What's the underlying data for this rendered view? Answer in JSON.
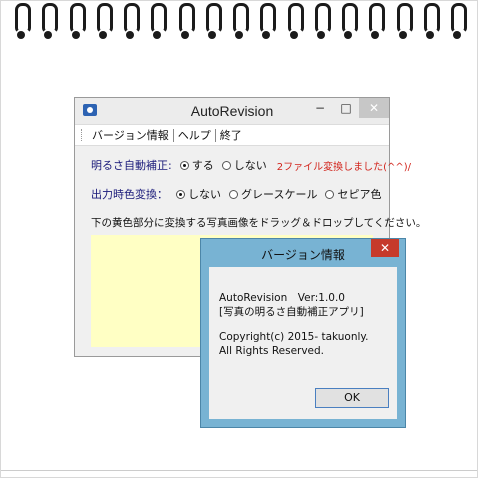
{
  "main_window": {
    "title": "AutoRevision",
    "controls": {
      "minimize": "−",
      "maximize": "□",
      "close": "✕"
    },
    "menu": {
      "version": "バージョン情報",
      "help": "ヘルプ",
      "exit": "終了"
    },
    "brightness": {
      "label": "明るさ自動補正:",
      "on_label": "する",
      "off_label": "しない",
      "selected": "する",
      "status": "2ファイル変換しました(^^)/"
    },
    "output_color": {
      "label": "出力時色変換：",
      "none_label": "しない",
      "grayscale_label": "グレースケール",
      "sepia_label": "セピア色",
      "selected": "しない"
    },
    "instruction": "下の黄色部分に変換する写真画像をドラッグ＆ドロップしてください。"
  },
  "version_dialog": {
    "title": "バージョン情報",
    "close": "✕",
    "app_version": "AutoRevision　Ver:1.0.0",
    "app_description": "[写真の明るさ自動補正アプリ]",
    "copyright": "Copyright(c) 2015- takuonly.",
    "rights": "All Rights Reserved.",
    "ok_label": "OK"
  }
}
